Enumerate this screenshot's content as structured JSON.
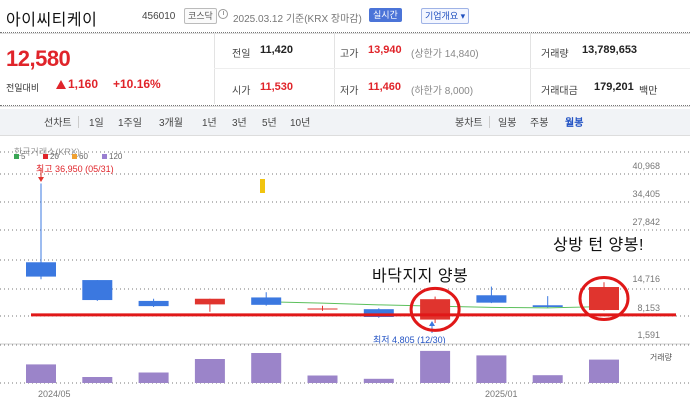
{
  "header": {
    "name": "아이씨티케이",
    "code": "456010",
    "market_badge": "코스닥",
    "date_text": "2025.03.12 기준(KRX 장마감)",
    "live_label": "실시간",
    "corp_label": "기업개요 ▾"
  },
  "quote": {
    "price": "12,580",
    "change_label": "전일대비",
    "change_value": "1,160",
    "change_pct": "+10.16%",
    "prev_close_label": "전일",
    "prev_close": "11,420",
    "high_label": "고가",
    "high": "13,940",
    "upper_limit": "(상한가 14,840)",
    "volume_label": "거래량",
    "volume": "13,789,653",
    "open_label": "시가",
    "open": "11,530",
    "low_label": "저가",
    "low": "11,460",
    "lower_limit": "(하한가 8,000)",
    "value_label": "거래대금",
    "value": "179,201",
    "value_unit": "백만"
  },
  "tabs": {
    "line": "선차트",
    "periods": [
      "1일",
      "1주일",
      "3개월",
      "1년",
      "3년",
      "5년",
      "10년"
    ],
    "candle": "봉차트",
    "candle_periods": [
      "일봉",
      "주봉",
      "월봉"
    ],
    "active": "월봉"
  },
  "chart": {
    "source_label": "한국거래소(KRX)",
    "ma": [
      {
        "label": "5",
        "color": "#3aa655"
      },
      {
        "label": "20",
        "color": "#e0242a"
      },
      {
        "label": "60",
        "color": "#f0a030"
      },
      {
        "label": "120",
        "color": "#9a7fd1"
      }
    ],
    "y_ticks": [
      "40,968",
      "34,405",
      "27,842",
      "21,279",
      "14,716",
      "8,153",
      "1,591"
    ],
    "high_note": "최고 36,950 (05/31)",
    "low_note": "최저 4,805 (12/30)",
    "volume_label": "거래량",
    "x_ticks": [
      "2024/05",
      "2025/01"
    ],
    "annot_bottom": "바닥지지 양봉",
    "annot_top": "상방 턴 양봉!",
    "colors": {
      "up": "#e0342e",
      "down": "#3b78e0",
      "volume": "#9b84c9",
      "circle": "#e01818",
      "support": "#e01818"
    }
  },
  "chart_data": {
    "type": "candlestick",
    "y_axis": {
      "min": 1591,
      "max": 40968,
      "ticks": [
        40968,
        34405,
        27842,
        21279,
        14716,
        8153,
        1591
      ]
    },
    "candles": [
      {
        "open": 18800,
        "close": 15500,
        "high": 36950,
        "low": 14900,
        "dir": "down"
      },
      {
        "open": 14700,
        "close": 10100,
        "high": 14700,
        "low": 9900,
        "dir": "down"
      },
      {
        "open": 9900,
        "close": 8700,
        "high": 10400,
        "low": 8500,
        "dir": "down"
      },
      {
        "open": 9100,
        "close": 10400,
        "high": 10400,
        "low": 7400,
        "dir": "up"
      },
      {
        "open": 10700,
        "close": 9000,
        "high": 11900,
        "low": 8800,
        "dir": "down"
      },
      {
        "open": 8153,
        "close": 8153,
        "high": 8800,
        "low": 7600,
        "dir": "up"
      },
      {
        "open": 8000,
        "close": 6200,
        "high": 8200,
        "low": 6000,
        "dir": "down"
      },
      {
        "open": 5600,
        "close": 10300,
        "high": 10900,
        "low": 4805,
        "dir": "up"
      },
      {
        "open": 11200,
        "close": 9500,
        "high": 13200,
        "low": 9400,
        "dir": "down"
      },
      {
        "open": 8900,
        "close": 8500,
        "high": 11000,
        "low": 8400,
        "dir": "down"
      },
      {
        "open": 7800,
        "close": 13100,
        "high": 14200,
        "low": 7700,
        "dir": "up"
      }
    ],
    "volume_relative": [
      0.62,
      0.2,
      0.35,
      0.8,
      1.0,
      0.25,
      0.14,
      1.07,
      0.92,
      0.26,
      0.78
    ],
    "ma20": [
      null,
      null,
      null,
      null,
      9700,
      9400,
      9000,
      8700,
      8400,
      8300,
      8600
    ],
    "support_level": 6700
  }
}
